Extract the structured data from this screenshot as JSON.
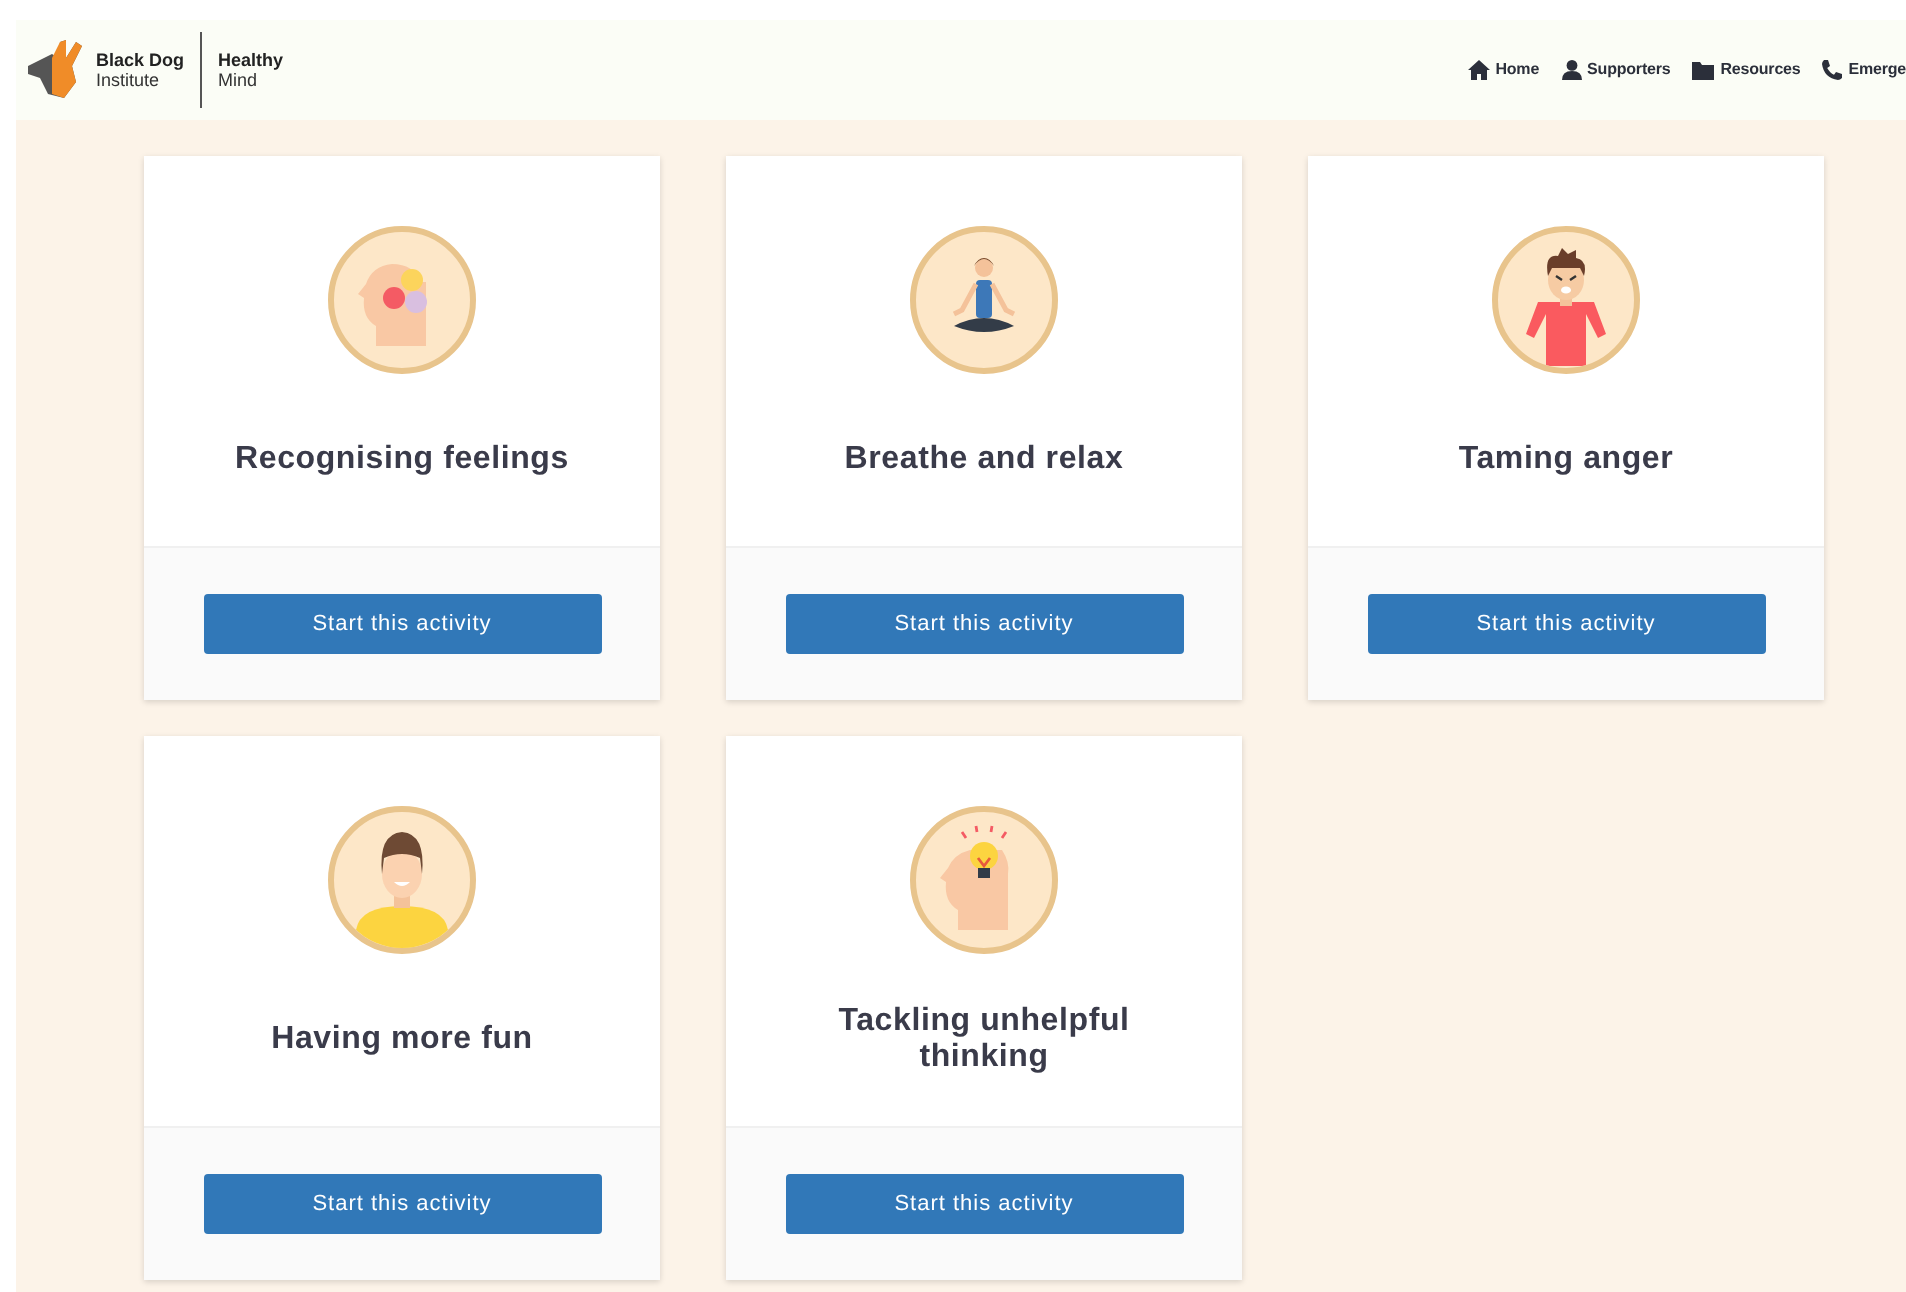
{
  "header": {
    "logo": {
      "brand_line1": "Black Dog",
      "brand_line2": "Institute",
      "product_line1": "Healthy",
      "product_line2": "Mind"
    },
    "nav": [
      {
        "label": "Home",
        "kind": "home"
      },
      {
        "label": "Supporters",
        "kind": "person"
      },
      {
        "label": "Resources",
        "kind": "folder"
      },
      {
        "label": "Emerge",
        "kind": "phone"
      }
    ]
  },
  "activities": [
    {
      "title": "Recognising feelings",
      "kind": "feelings",
      "button": "Start this activity"
    },
    {
      "title": "Breathe and relax",
      "kind": "meditation",
      "button": "Start this activity"
    },
    {
      "title": "Taming anger",
      "kind": "anger",
      "button": "Start this activity"
    },
    {
      "title": "Having more fun",
      "kind": "happy",
      "button": "Start this activity"
    },
    {
      "title": "Tackling unhelpful thinking",
      "kind": "idea",
      "button": "Start this activity"
    }
  ]
}
